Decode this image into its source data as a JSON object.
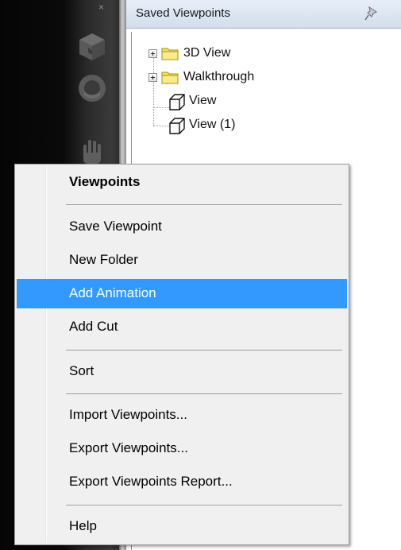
{
  "panel": {
    "title": "Saved Viewpoints",
    "tree": [
      {
        "label": "3D View",
        "kind": "folder"
      },
      {
        "label": "Walkthrough",
        "kind": "folder"
      },
      {
        "label": "View",
        "kind": "viewpoint"
      },
      {
        "label": "View (1)",
        "kind": "viewpoint"
      }
    ]
  },
  "navbar": {
    "close_glyph": "×",
    "icons": [
      "viewcube-icon",
      "steering-wheel-icon",
      "pan-hand-icon"
    ]
  },
  "context_menu": {
    "header": "Viewpoints",
    "items": [
      {
        "label": "Save Viewpoint"
      },
      {
        "label": "New Folder"
      },
      {
        "label": "Add Animation",
        "highlighted": true
      },
      {
        "label": "Add Cut"
      },
      {
        "label": "Sort"
      },
      {
        "label": "Import Viewpoints..."
      },
      {
        "label": "Export Viewpoints..."
      },
      {
        "label": "Export Viewpoints Report..."
      },
      {
        "label": "Help"
      }
    ]
  },
  "colors": {
    "menu_highlight": "#3399ff",
    "folder_fill": "#f7e56a",
    "header_bg": "#dde6f2"
  }
}
